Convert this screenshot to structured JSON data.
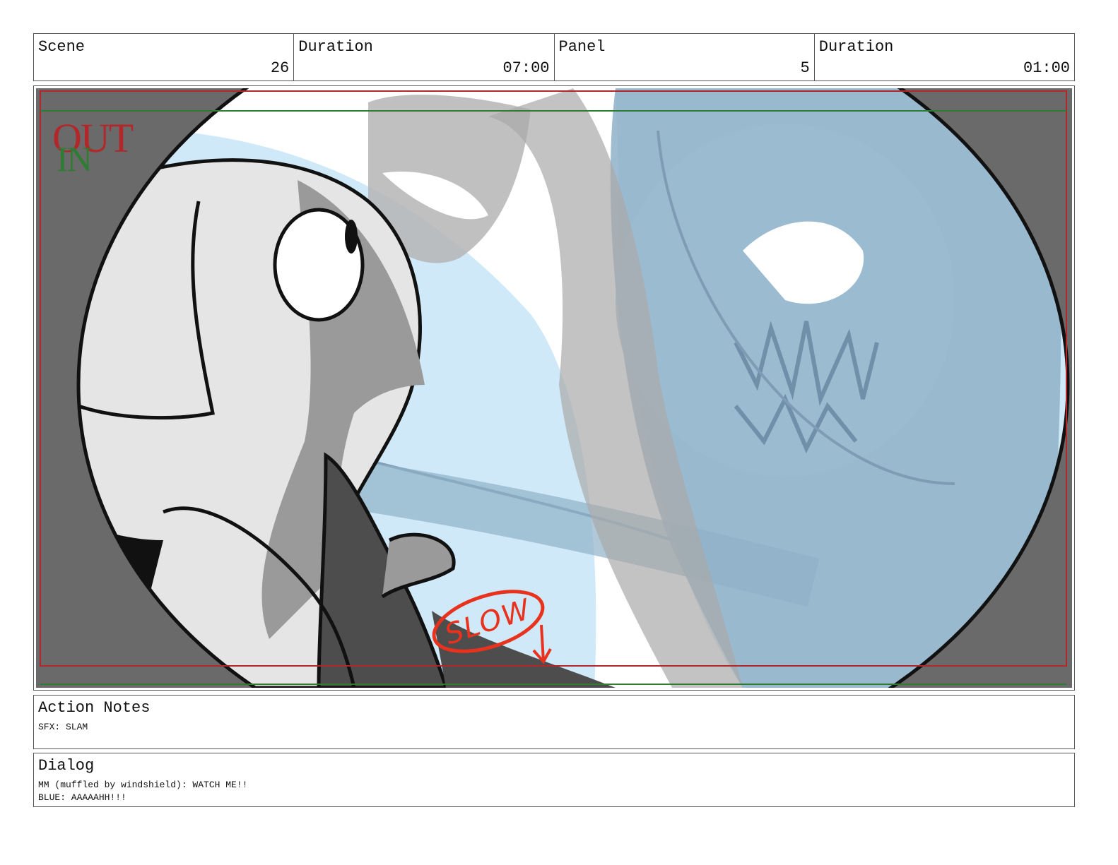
{
  "header": {
    "scene": {
      "label": "Scene",
      "value": "26"
    },
    "scene_duration": {
      "label": "Duration",
      "value": "07:00"
    },
    "panel": {
      "label": "Panel",
      "value": "5"
    },
    "panel_duration": {
      "label": "Duration",
      "value": "01:00"
    }
  },
  "frame": {
    "safe_out_label": "OUT",
    "safe_in_label": "IN",
    "annotation_word": "SLOW",
    "colors": {
      "out_guide": "#b3262a",
      "in_guide": "#2f7d32",
      "annotation": "#e8321e",
      "sky": "#cfe9f8",
      "shadow_blue": "#8fb0c8",
      "vignette": "#6a6a6a"
    }
  },
  "action_notes": {
    "title": "Action Notes",
    "lines": [
      "SFX: SLAM"
    ]
  },
  "dialog": {
    "title": "Dialog",
    "lines": [
      "MM (muffled by windshield): WATCH ME!!",
      "BLUE: AAAAAHH!!!"
    ]
  }
}
